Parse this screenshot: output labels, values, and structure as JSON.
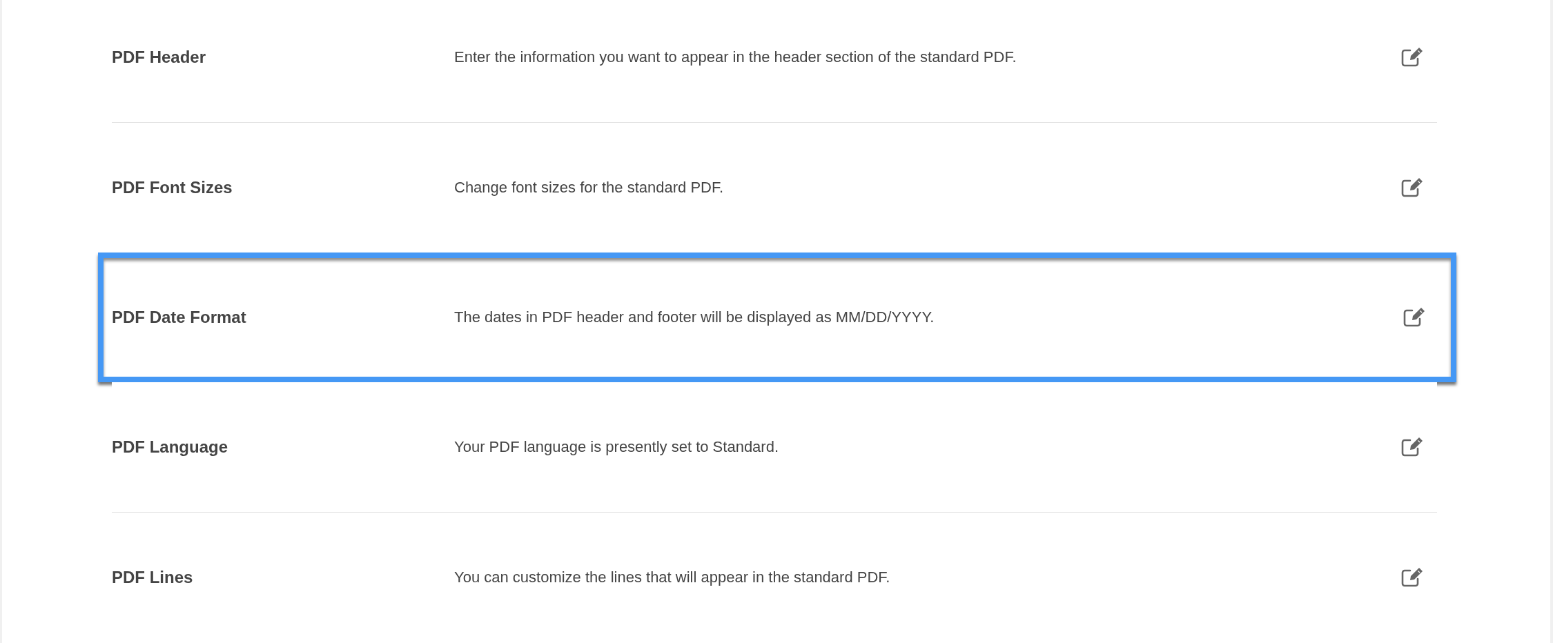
{
  "settings": [
    {
      "label": "PDF Header",
      "description": "Enter the information you want to appear in the header section of the standard PDF.",
      "highlighted": false
    },
    {
      "label": "PDF Font Sizes",
      "description": "Change font sizes for the standard PDF.",
      "highlighted": false
    },
    {
      "label": "PDF Date Format",
      "description": "The dates in PDF header and footer will be displayed as MM/DD/YYYY.",
      "highlighted": true
    },
    {
      "label": "PDF Language",
      "description": "Your PDF language is presently set to Standard.",
      "highlighted": false
    },
    {
      "label": "PDF Lines",
      "description": "You can customize the lines that will appear in the standard PDF.",
      "highlighted": false
    }
  ]
}
